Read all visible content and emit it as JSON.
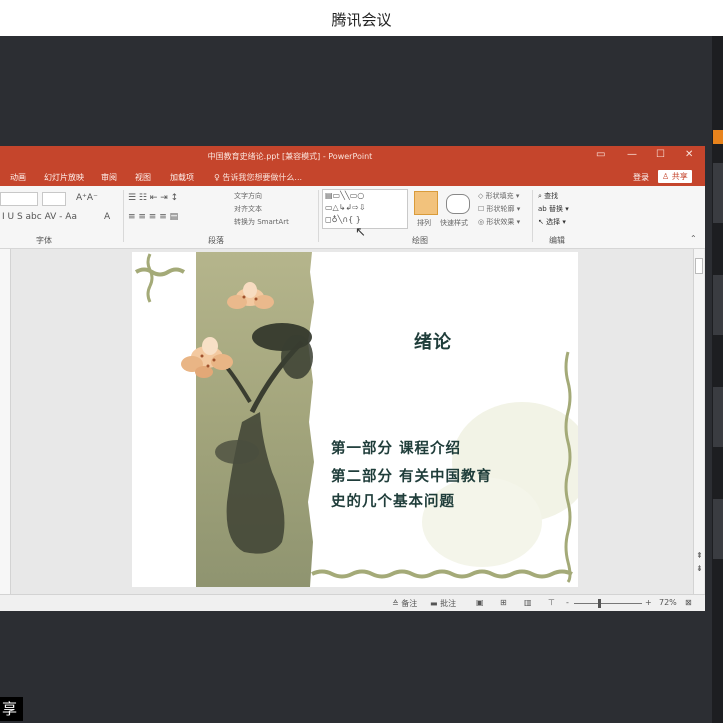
{
  "app": {
    "title": "腾讯会议",
    "share_label": "享"
  },
  "ppt": {
    "doc_title": "中国教育史绪论.ppt [兼容模式] - PowerPoint",
    "tabs": [
      "动画",
      "幻灯片放映",
      "审阅",
      "视图",
      "加载项"
    ],
    "tell_me": "告诉我您想要做什么...",
    "login": "登录",
    "share": "共享",
    "groups": {
      "font": "字体",
      "paragraph": "段落",
      "drawing": "绘图",
      "editing": "编辑"
    },
    "ribbon": {
      "text_direction": "文字方向",
      "align_text": "对齐文本",
      "convert_smartart": "转换为 SmartArt",
      "arrange": "排列",
      "quick_styles": "快速样式",
      "shape_fill": "形状填充",
      "shape_outline": "形状轮廓",
      "shape_effects": "形状效果",
      "find": "查找",
      "replace": "替换",
      "select": "选择"
    },
    "status": {
      "notes": "备注",
      "comments": "批注",
      "zoom": "72%"
    }
  },
  "slide": {
    "title": "绪论",
    "lines": [
      "第一部分  课程介绍",
      "第二部分  有关中国教育",
      "史的几个基本问题"
    ]
  },
  "colors": {
    "ribbon": "#c5452c",
    "slide_text": "#1f3d3a"
  }
}
